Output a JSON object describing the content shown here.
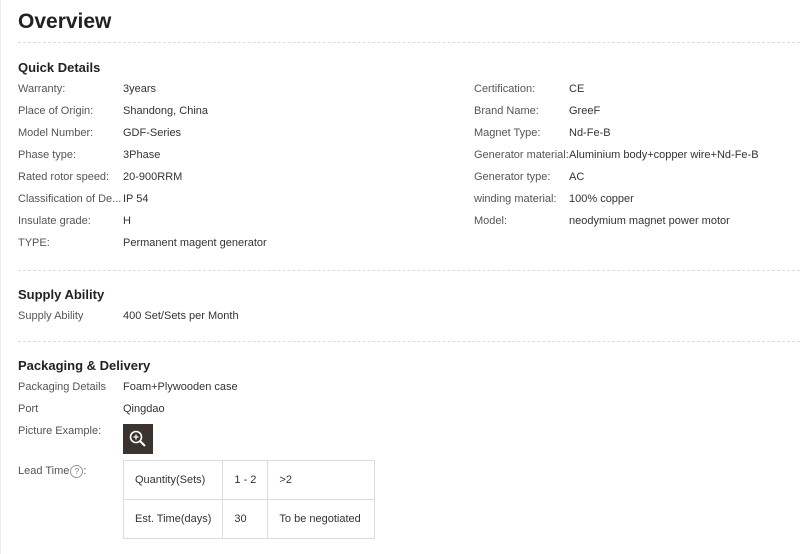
{
  "title": "Overview",
  "quick_details": {
    "heading": "Quick Details",
    "left": [
      {
        "label": "Warranty:",
        "value": "3years"
      },
      {
        "label": "Place of Origin:",
        "value": "Shandong, China"
      },
      {
        "label": "Model Number:",
        "value": "GDF-Series"
      },
      {
        "label": "Phase type:",
        "value": "3Phase"
      },
      {
        "label": "Rated rotor speed:",
        "value": "20-900RRM"
      },
      {
        "label": "Classification of De...",
        "value": "IP 54"
      },
      {
        "label": "Insulate grade:",
        "value": "H"
      },
      {
        "label": "TYPE:",
        "value": "Permanent magent generator"
      }
    ],
    "right": [
      {
        "label": "Certification:",
        "value": "CE"
      },
      {
        "label": "Brand Name:",
        "value": "GreeF"
      },
      {
        "label": "Magnet Type:",
        "value": "Nd-Fe-B"
      },
      {
        "label": "Generator material:",
        "value": "Aluminium body+copper wire+Nd-Fe-B"
      },
      {
        "label": "Generator type:",
        "value": "AC"
      },
      {
        "label": "winding material:",
        "value": "100% copper"
      },
      {
        "label": "Model:",
        "value": "neodymium magnet power motor"
      }
    ]
  },
  "supply_ability": {
    "heading": "Supply Ability",
    "label": "Supply Ability",
    "value": "400 Set/Sets per Month"
  },
  "packaging": {
    "heading": "Packaging & Delivery",
    "details_label": "Packaging Details",
    "details_value": "Foam+Plywooden case",
    "port_label": "Port",
    "port_value": "Qingdao",
    "picture_label": "Picture Example:",
    "picture_icon": "zoom-icon",
    "lead_time_label": "Lead Time",
    "lead_time_suffix": ":",
    "help_glyph": "?",
    "lead_table": {
      "row1": [
        "Quantity(Sets)",
        "1 - 2",
        ">2"
      ],
      "row2": [
        "Est. Time(days)",
        "30",
        "To be negotiated"
      ]
    }
  }
}
